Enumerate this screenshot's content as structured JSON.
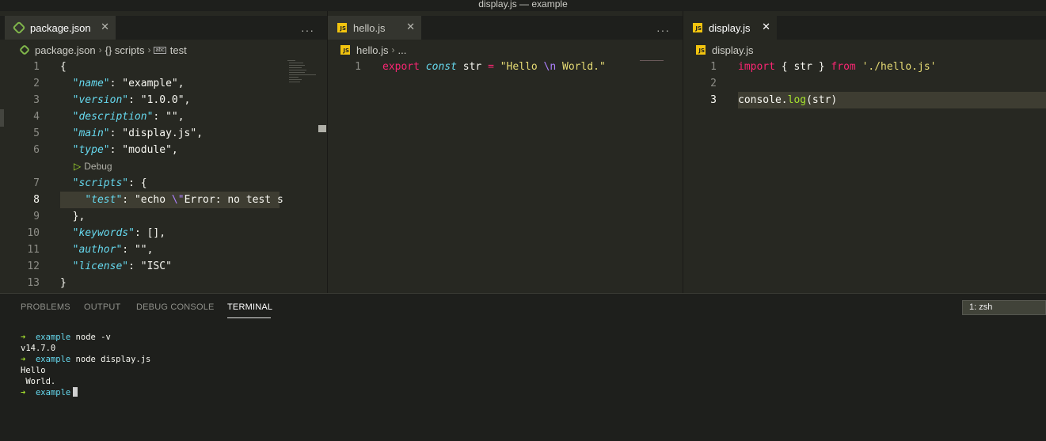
{
  "window": {
    "title": "display.js — example"
  },
  "editors": {
    "left": {
      "tab_label": "package.json",
      "breadcrumb": [
        "package.json",
        "{} scripts",
        "test"
      ],
      "code_lens": "Debug",
      "lines": [
        {
          "n": "1",
          "parts": [
            [
              "plain",
              "{"
            ]
          ]
        },
        {
          "n": "2",
          "parts": [
            [
              "plain",
              "  "
            ],
            [
              "key",
              "\"name\""
            ],
            [
              "plain",
              ": "
            ],
            [
              "plain",
              "\"example\","
            ]
          ]
        },
        {
          "n": "3",
          "parts": [
            [
              "plain",
              "  "
            ],
            [
              "key",
              "\"version\""
            ],
            [
              "plain",
              ": "
            ],
            [
              "plain",
              "\"1.0.0\","
            ]
          ]
        },
        {
          "n": "4",
          "parts": [
            [
              "plain",
              "  "
            ],
            [
              "key",
              "\"description\""
            ],
            [
              "plain",
              ": "
            ],
            [
              "plain",
              "\"\","
            ]
          ]
        },
        {
          "n": "5",
          "parts": [
            [
              "plain",
              "  "
            ],
            [
              "key",
              "\"main\""
            ],
            [
              "plain",
              ": "
            ],
            [
              "plain",
              "\"display.js\","
            ]
          ]
        },
        {
          "n": "6",
          "parts": [
            [
              "plain",
              "  "
            ],
            [
              "key",
              "\"type\""
            ],
            [
              "plain",
              ": "
            ],
            [
              "plain",
              "\"module\","
            ]
          ]
        },
        {
          "n": "7",
          "parts": [
            [
              "plain",
              "  "
            ],
            [
              "key",
              "\"scripts\""
            ],
            [
              "plain",
              ": {"
            ]
          ]
        },
        {
          "n": "8",
          "parts": [
            [
              "plain",
              "    "
            ],
            [
              "key",
              "\"test\""
            ],
            [
              "plain",
              ": "
            ],
            [
              "plain",
              "\"echo "
            ],
            [
              "esc",
              "\\\""
            ],
            [
              "plain",
              "Error: no test sp"
            ]
          ]
        },
        {
          "n": "9",
          "parts": [
            [
              "plain",
              "  },"
            ]
          ]
        },
        {
          "n": "10",
          "parts": [
            [
              "plain",
              "  "
            ],
            [
              "key",
              "\"keywords\""
            ],
            [
              "plain",
              ": [],"
            ]
          ]
        },
        {
          "n": "11",
          "parts": [
            [
              "plain",
              "  "
            ],
            [
              "key",
              "\"author\""
            ],
            [
              "plain",
              ": "
            ],
            [
              "plain",
              "\"\","
            ]
          ]
        },
        {
          "n": "12",
          "parts": [
            [
              "plain",
              "  "
            ],
            [
              "key",
              "\"license\""
            ],
            [
              "plain",
              ": "
            ],
            [
              "plain",
              "\"ISC\""
            ]
          ]
        },
        {
          "n": "13",
          "parts": [
            [
              "plain",
              "}"
            ]
          ]
        }
      ]
    },
    "middle": {
      "tab_label": "hello.js",
      "breadcrumb": [
        "hello.js",
        "..."
      ],
      "lines": [
        {
          "n": "1",
          "parts": [
            [
              "kw",
              "export "
            ],
            [
              "kwi",
              "const "
            ],
            [
              "plain",
              "str "
            ],
            [
              "kw",
              "= "
            ],
            [
              "str",
              "\"Hello "
            ],
            [
              "esc",
              "\\n"
            ],
            [
              "str",
              " World.\""
            ]
          ]
        }
      ]
    },
    "right": {
      "tab_label": "display.js",
      "breadcrumb": [
        "display.js"
      ],
      "lines": [
        {
          "n": "1",
          "parts": [
            [
              "kw",
              "import "
            ],
            [
              "plain",
              "{ str } "
            ],
            [
              "kw",
              "from "
            ],
            [
              "str",
              "'./hello.js'"
            ]
          ]
        },
        {
          "n": "2",
          "parts": []
        },
        {
          "n": "3",
          "parts": [
            [
              "plain",
              "console."
            ],
            [
              "fn",
              "log"
            ],
            [
              "plain",
              "(str)"
            ]
          ]
        }
      ]
    }
  },
  "panel": {
    "tabs": [
      "PROBLEMS",
      "OUTPUT",
      "DEBUG CONSOLE",
      "TERMINAL"
    ],
    "active_tab": "TERMINAL",
    "terminal_select": "1: zsh",
    "terminal_lines": [
      {
        "prompt": true,
        "dir": "example",
        "cmd": "node -v"
      },
      {
        "prompt": false,
        "text": "v14.7.0"
      },
      {
        "prompt": true,
        "dir": "example",
        "cmd": "node display.js"
      },
      {
        "prompt": false,
        "text": "Hello"
      },
      {
        "prompt": false,
        "text": " World."
      },
      {
        "prompt": true,
        "dir": "example",
        "cmd": "",
        "cursor": true
      }
    ]
  },
  "icons": {
    "more": "more-actions-icon",
    "close": "close-icon",
    "chevron": "chevron-right-icon"
  },
  "colors": {
    "background": "#272822",
    "panel": "#1e1f1c",
    "accent_green": "#a6e22e",
    "accent_cyan": "#66d9ef"
  }
}
